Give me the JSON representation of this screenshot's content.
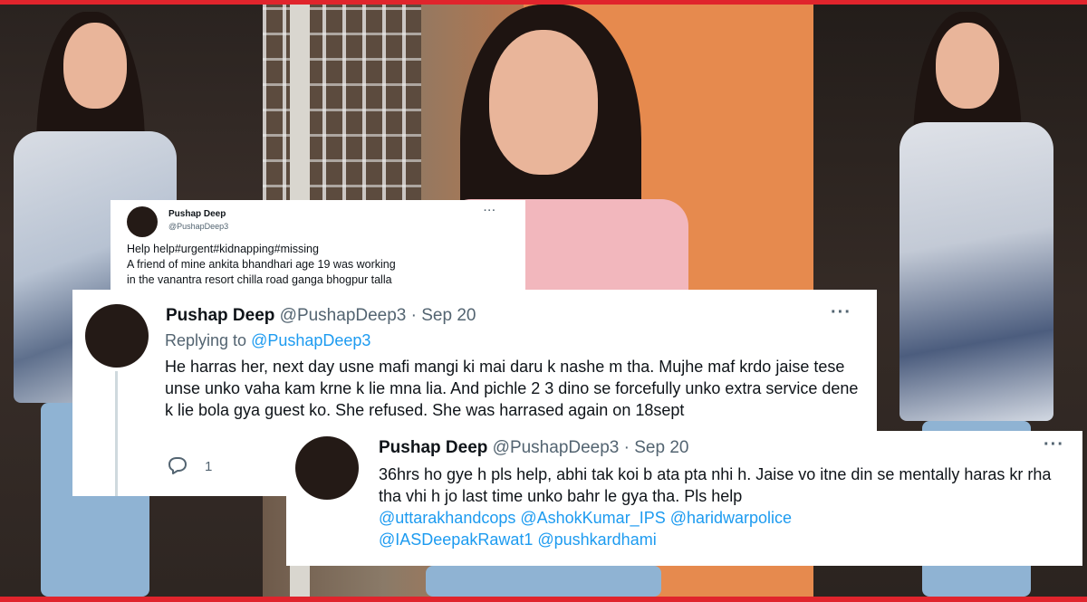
{
  "tweet1": {
    "name": "Pushap Deep",
    "handle": "@PushapDeep3",
    "more": "···",
    "text": "Help help#urgent#kidnapping#missing\nA friend of mine ankita bhandhari age 19 was working\nin the vanantra resort chilla road ganga bhogpur talla"
  },
  "tweet2": {
    "name": "Pushap Deep",
    "handle_date": "@PushapDeep3 · Sep 20",
    "more": "···",
    "replying_label": "Replying to ",
    "replying_handle": "@PushapDeep3",
    "text": "He harras her, next day usne mafi mangi ki mai daru k nashe m tha. Mujhe maf krdo jaise tese unse unko vaha kam krne k lie mna lia. And pichle 2 3 dino se forcefully unko extra service dene k lie bola gya guest ko. She refused. She was harrased again on 18sept",
    "reply_count": "1",
    "reply_icon": "reply-bubble-icon"
  },
  "tweet3": {
    "name": "Pushap Deep",
    "handle_date": "@PushapDeep3 · Sep 20",
    "more": "···",
    "text": "36hrs ho gye h pls help, abhi tak koi b ata pta nhi h. Jaise vo itne din se mentally haras kr rha tha vhi h jo last time unko bahr le gya tha. Pls help",
    "mentions_line1": "@uttarakhandcops @AshokKumar_IPS @haridwarpolice",
    "mentions_line2": "@IASDeepakRawat1 @pushkardhami"
  },
  "colors": {
    "frame": "#e0242c",
    "mention": "#1d9bf0",
    "secondary_text": "#536471"
  }
}
